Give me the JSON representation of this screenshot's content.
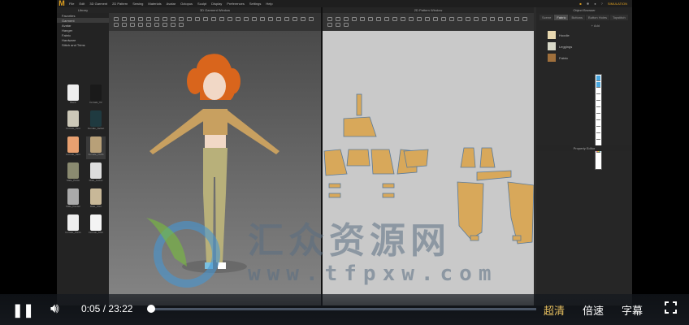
{
  "app": {
    "menu": [
      "File",
      "Edit",
      "3D Garment",
      "2D Pattern",
      "Sewing",
      "Materials",
      "Avatar",
      "Octopus",
      "Sculpt",
      "Display",
      "Preferences",
      "Settings",
      "Help"
    ],
    "user": "SIMULATION",
    "library": {
      "title": "Library",
      "categories": [
        "Favorites",
        "Garment",
        "Avatar",
        "Hanger",
        "Fabric",
        "Hardware",
        "Stitch and Trims"
      ],
      "items": [
        "Blank",
        "Female_V2",
        "Female_Vest",
        "Female_Jacket",
        "Female_Skirt",
        "Female_Outfit",
        "Male_Pants",
        "Male_Jacket",
        "Male_Pants2",
        "Male_Shirt",
        "Female_Pants",
        "Female_Shirt"
      ],
      "selected": 5
    },
    "window3d": "3D Garment Window",
    "window2d": "2D Pattern Window",
    "object_browser": {
      "title": "Object Browser",
      "tabs": [
        "Scene",
        "Fabric",
        "Buttons",
        "Button Holes",
        "Topstitch"
      ],
      "active_tab": 1,
      "add_label": "+ Add",
      "fabrics": [
        {
          "name": "Hoodie",
          "color": "#e8d8b0"
        },
        {
          "name": "Leggings",
          "color": "#d8d8c8"
        },
        {
          "name": "Fabric",
          "color": "#a0703c"
        }
      ]
    },
    "property_editor": "Property Editor"
  },
  "watermark": {
    "text": "汇众资源网",
    "url": "www.tfpxw.com"
  },
  "player": {
    "current_time": "0:05",
    "total_time": "23:22",
    "time_separator": "/",
    "progress": 0.004,
    "quality": "超清",
    "speed": "倍速",
    "subtitle": "字幕"
  }
}
